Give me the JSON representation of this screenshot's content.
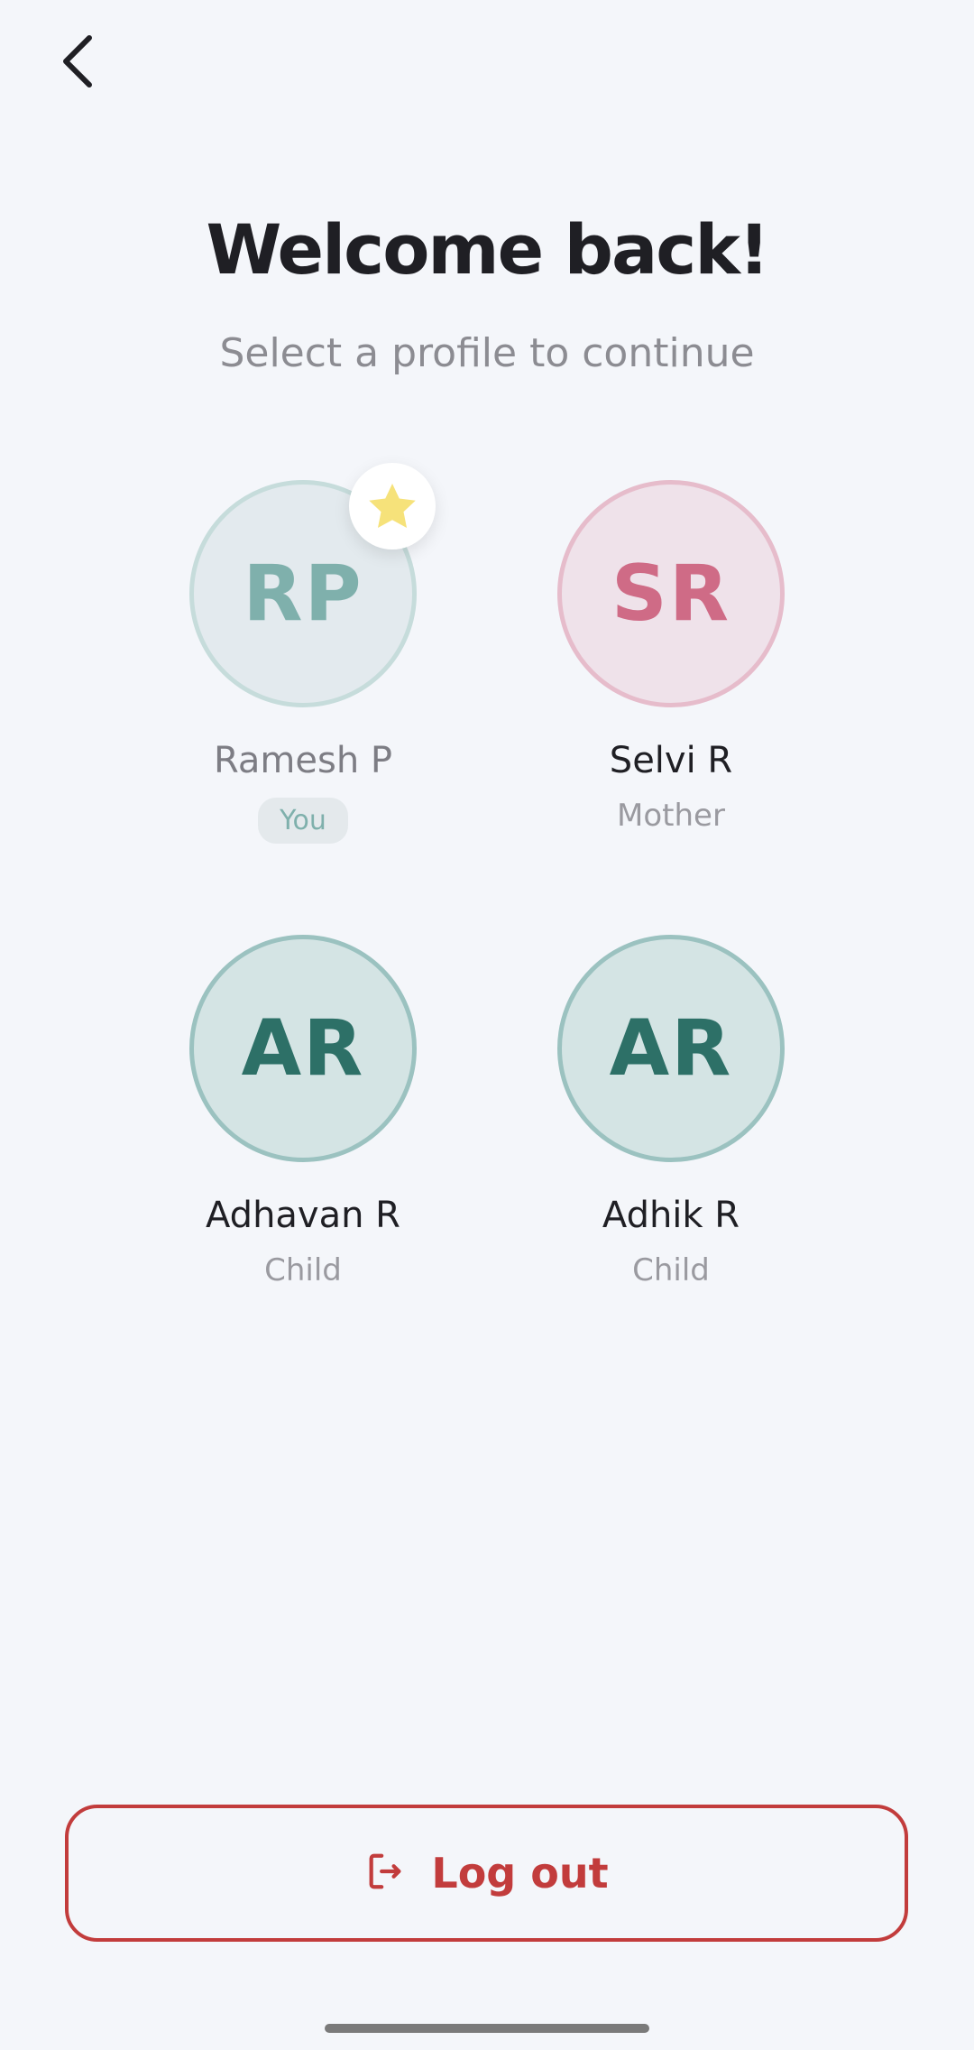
{
  "header": {
    "back_icon": "chevron-left-icon",
    "title": "Welcome back!",
    "subtitle": "Select a profile to continue"
  },
  "profiles": [
    {
      "initials": "RP",
      "name": "Ramesh P",
      "tag": "You",
      "badge_icon": "star-icon",
      "color": "#7fb0ac"
    },
    {
      "initials": "SR",
      "name": "Selvi R",
      "role": "Mother",
      "color": "#cf6b86"
    },
    {
      "initials": "AR",
      "name": "Adhavan R",
      "role": "Child",
      "color": "#2d7067"
    },
    {
      "initials": "AR",
      "name": "Adhik R",
      "role": "Child",
      "color": "#2d7067"
    }
  ],
  "footer": {
    "logout_label": "Log out",
    "logout_icon": "logout-icon",
    "accent": "#c23c3c"
  }
}
